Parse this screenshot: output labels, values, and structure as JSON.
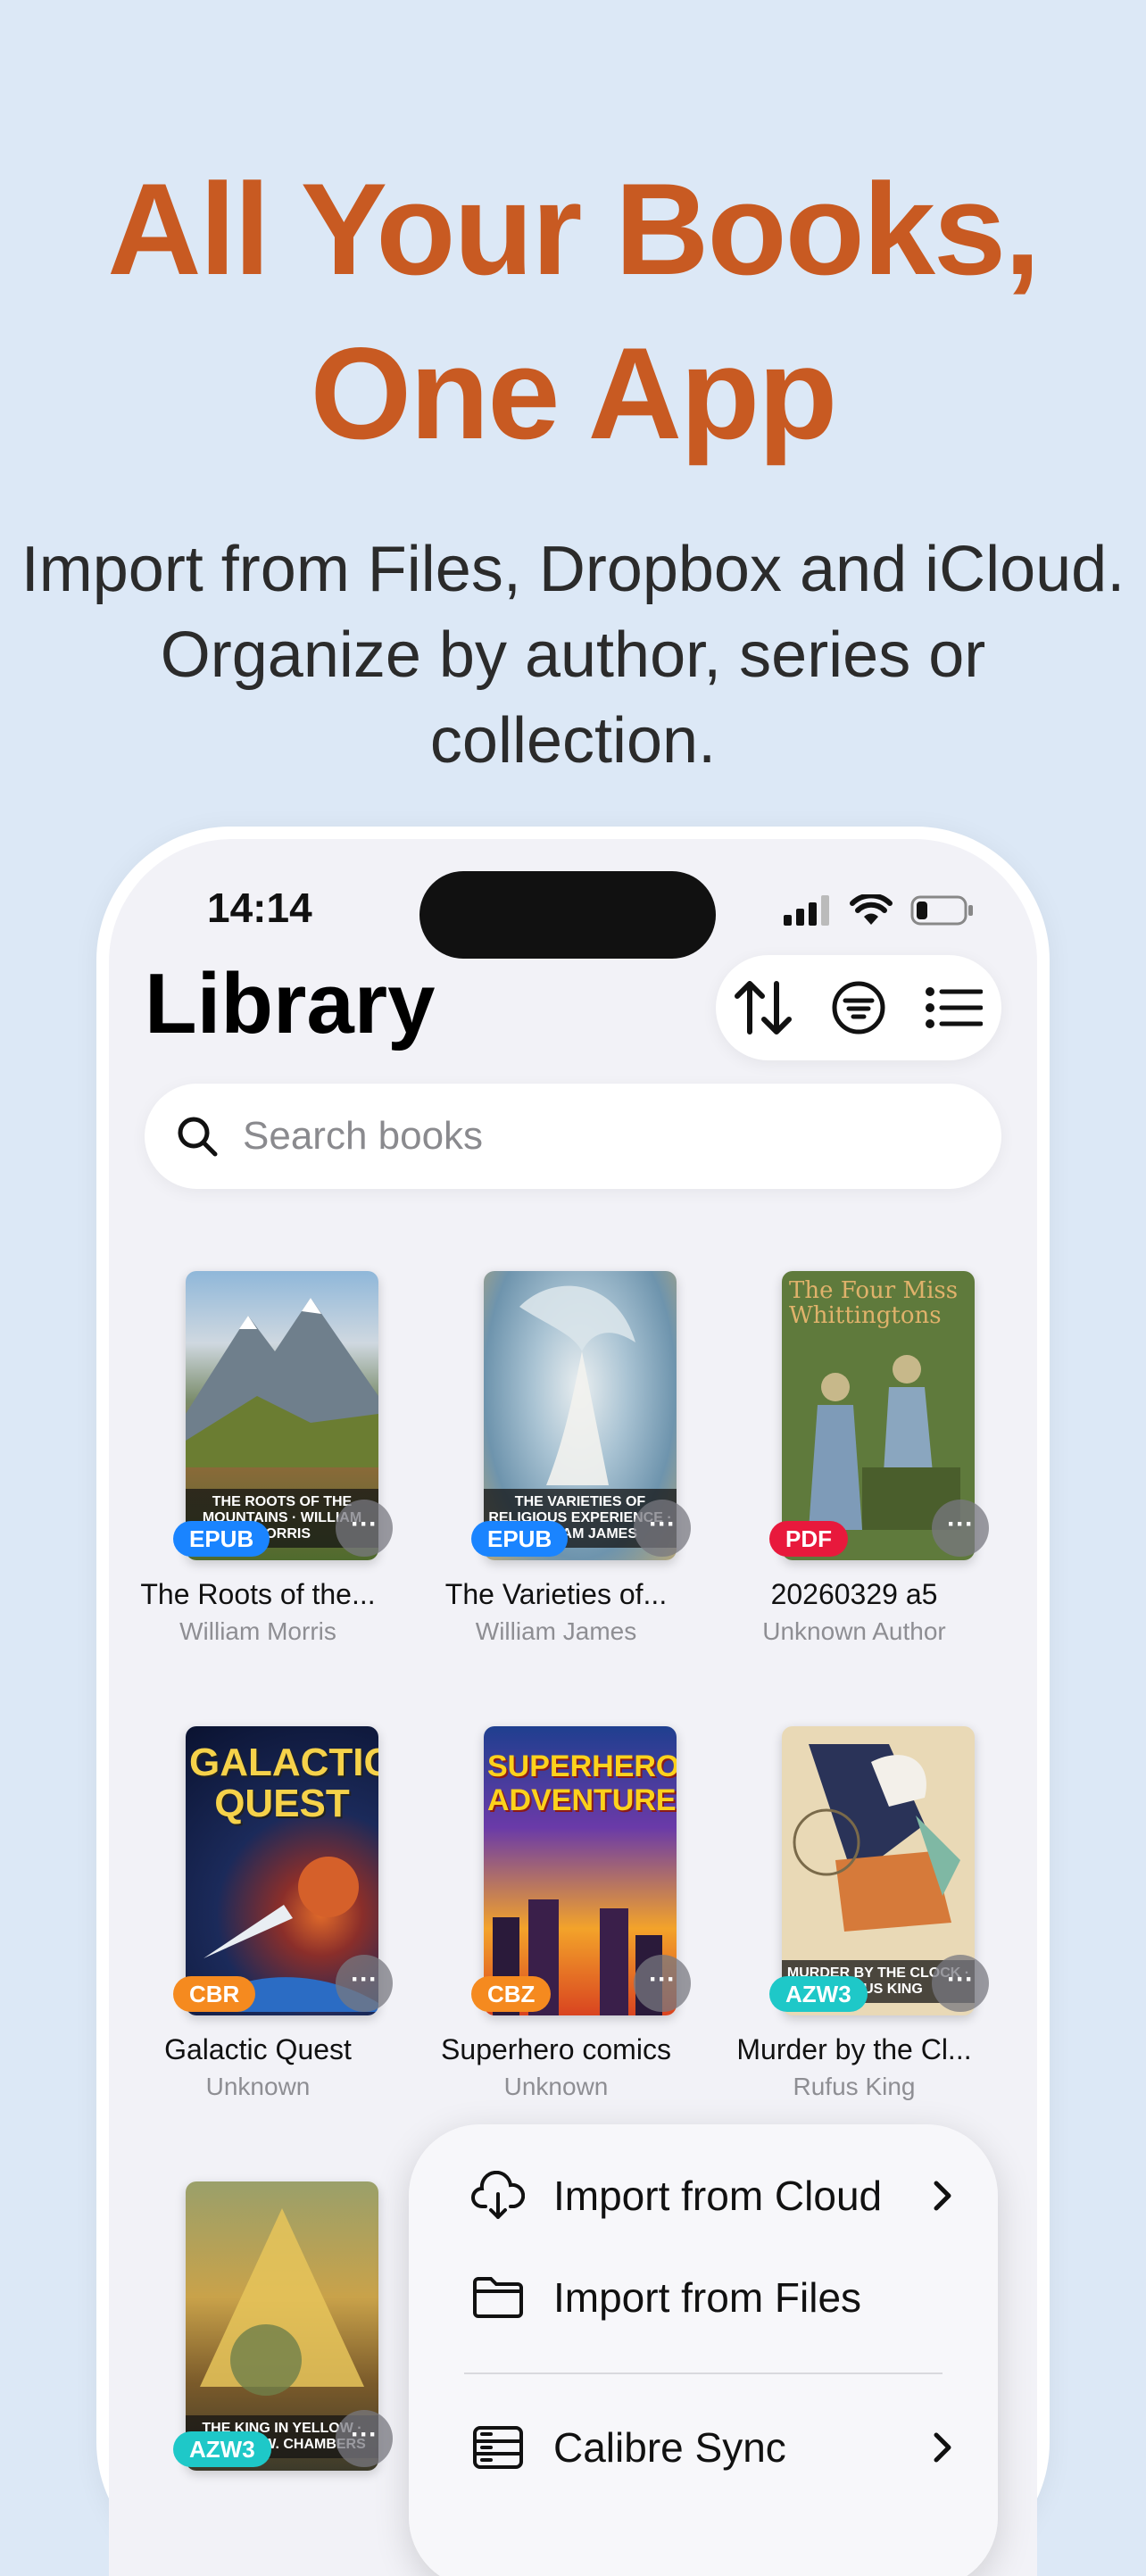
{
  "headline": {
    "line1": "All Your Books,",
    "line2": "One App"
  },
  "subtitle": {
    "line1": "Import from Files, Dropbox and iCloud.",
    "line2": "Organize by author, series or",
    "line3": "collection."
  },
  "status_bar": {
    "time": "14:14"
  },
  "library": {
    "title": "Library",
    "search_placeholder": "Search books",
    "toolbar_icons": [
      "sort-icon",
      "filter-icon",
      "list-view-icon"
    ],
    "books": [
      {
        "title": "The Roots of the...",
        "author": "William Morris",
        "format": "EPUB",
        "cover_text": "THE ROOTS OF THE MOUNTAINS · WILLIAM MORRIS",
        "badge_color": "#1a84ff"
      },
      {
        "title": "The Varieties of...",
        "author": "William James",
        "format": "EPUB",
        "cover_text": "THE VARIETIES OF RELIGIOUS EXPERIENCE · WILLIAM JAMES",
        "badge_color": "#1a84ff"
      },
      {
        "title": "20260329 a5",
        "author": "Unknown Author",
        "format": "PDF",
        "cover_text": "The Four Miss Whittingtons",
        "badge_color": "#e8193c"
      },
      {
        "title": "Galactic Quest",
        "author": "Unknown",
        "format": "CBR",
        "cover_text": "GALACTIC QUEST",
        "badge_color": "#f58a1f"
      },
      {
        "title": "Superhero comics",
        "author": "Unknown",
        "format": "CBZ",
        "cover_text": "SUPERHERO ADVENTURE",
        "badge_color": "#f58a1f"
      },
      {
        "title": "Murder by the Cl...",
        "author": "Rufus King",
        "format": "AZW3",
        "cover_text": "MURDER BY THE CLOCK · RUFUS KING",
        "badge_color": "#1ec8c8"
      },
      {
        "title": "",
        "author": "",
        "format": "AZW3",
        "cover_text": "THE KING IN YELLOW · ROBERT W. CHAMBERS",
        "badge_color": "#1ec8c8"
      }
    ]
  },
  "import_menu": {
    "items": [
      {
        "label": "Import from Cloud",
        "icon": "cloud-download-icon",
        "has_chevron": true
      },
      {
        "label": "Import from Files",
        "icon": "folder-icon",
        "has_chevron": false
      },
      {
        "label": "Calibre Sync",
        "icon": "server-icon",
        "has_chevron": true
      }
    ]
  },
  "colors": {
    "headline": "#c85a22",
    "background": "#dce8f6"
  }
}
